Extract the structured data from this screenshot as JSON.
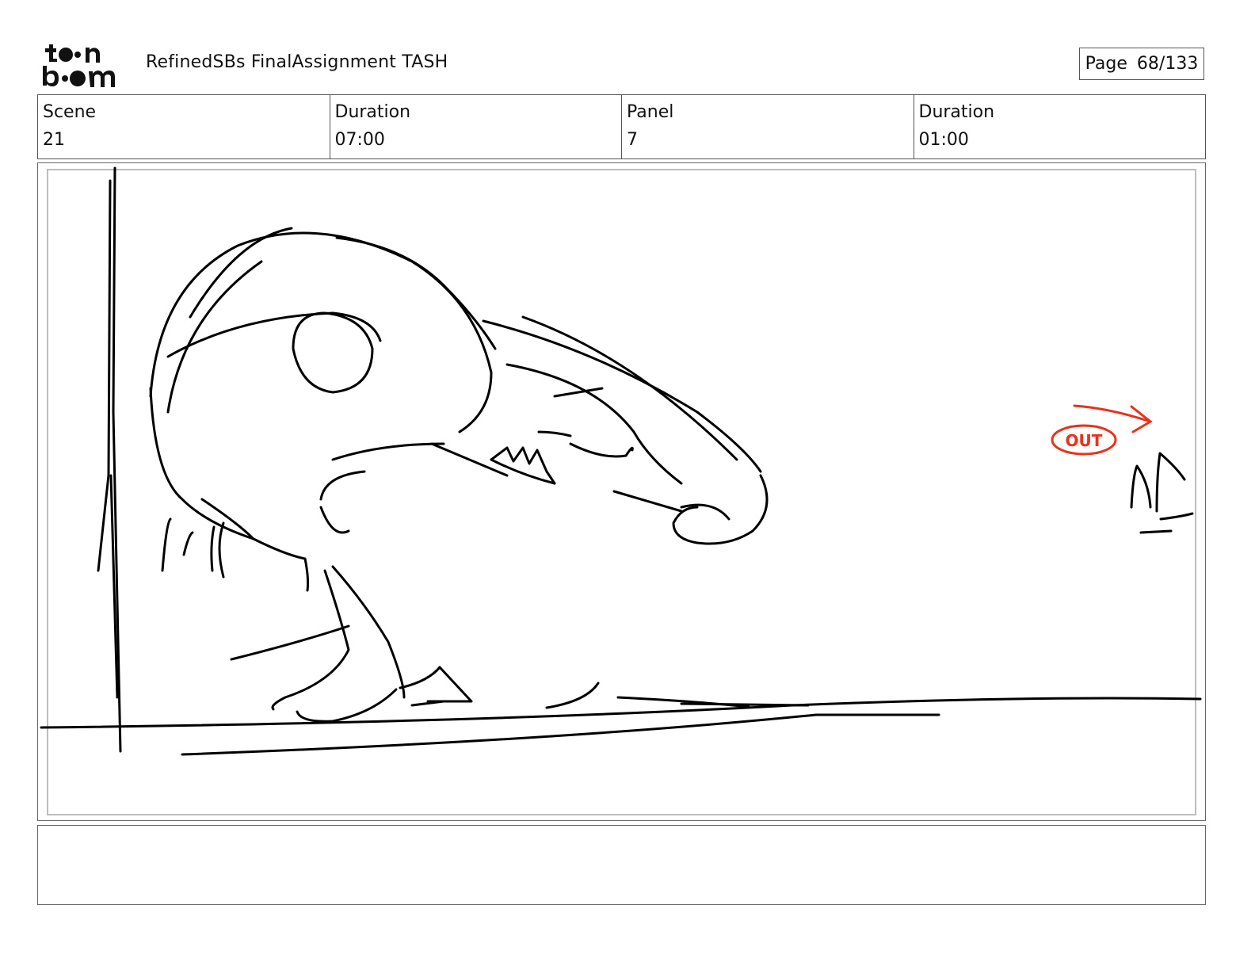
{
  "header": {
    "logo_text": "toon boom",
    "document_title": "RefinedSBs FinalAssignment TASH",
    "page_label": "Page",
    "page_value": "68/133"
  },
  "info": {
    "scene_label": "Scene",
    "scene_value": "21",
    "scene_duration_label": "Duration",
    "scene_duration_value": "07:00",
    "panel_label": "Panel",
    "panel_value": "7",
    "panel_duration_label": "Duration",
    "panel_duration_value": "01:00"
  },
  "panel": {
    "annotation_text": "OUT",
    "annotation_color": "#e8321b",
    "sketch_color": "#000000"
  },
  "notes": {
    "text": ""
  }
}
